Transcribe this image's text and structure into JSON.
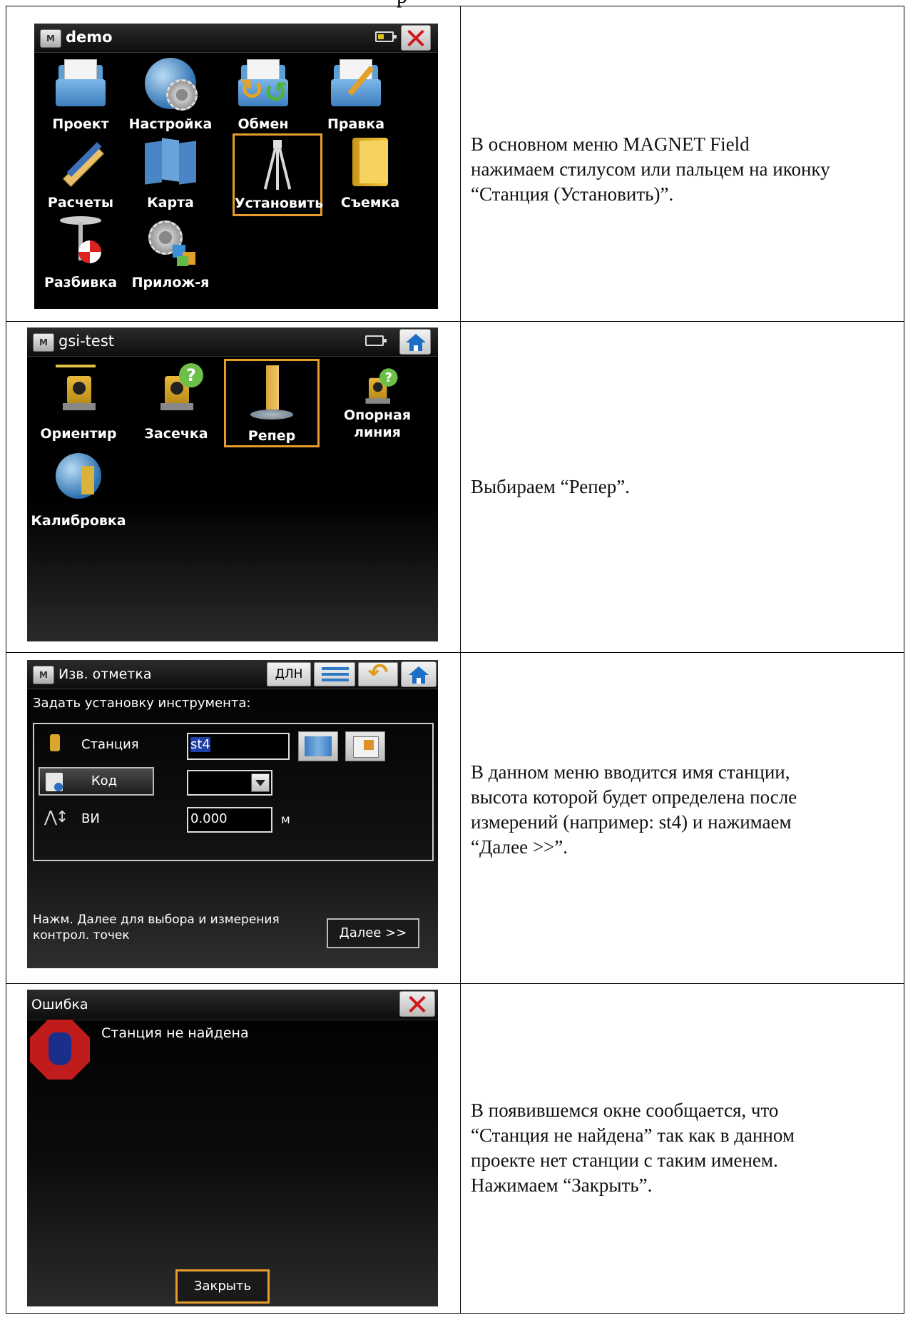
{
  "rows": [
    {
      "app_title": "demo",
      "menu_items": [
        "Проект",
        "Настройка",
        "Обмен",
        "Правка",
        "Расчеты",
        "Карта",
        "Установить",
        "Съемка",
        "Разбивка",
        "Прилож-я"
      ],
      "description": [
        "В основном меню MAGNET Field",
        "нажимаем стилусом или пальцем на иконку",
        "“Станция (Установить)”."
      ]
    },
    {
      "app_title": "gsi-test",
      "menu_items": [
        "Ориентир",
        "Засечка",
        "Репер",
        "Опорная",
        "линия",
        "Калибровка"
      ],
      "description": [
        "Выбираем “Репер”."
      ]
    },
    {
      "app_title": "Изв. отметка",
      "toolbar_label": "ДЛН",
      "prompt": "Задать установку инструмента:",
      "station_label": "Станция",
      "station_value": "st4",
      "code_button": "Код",
      "hi_label": "ВИ",
      "hi_value": "0.000",
      "hi_unit": "м",
      "hint_line1": "Нажм. Далее для выбора и измерения",
      "hint_line2": "контрол. точек",
      "next_button": "Далее >>",
      "description": [
        "В данном меню вводится имя станции,",
        "высота которой будет определена после",
        "измерений (например: st4) и нажимаем",
        "“Далее >>”."
      ]
    },
    {
      "app_title": "Ошибка",
      "message": "Станция не найдена",
      "close_button": "Закрыть",
      "description": [
        "В появившемся окне сообщается, что",
        "“Станция не найдена” так как в данном",
        "проекте нет станции с таким именем.",
        "Нажимаем “Закрыть”."
      ]
    }
  ]
}
